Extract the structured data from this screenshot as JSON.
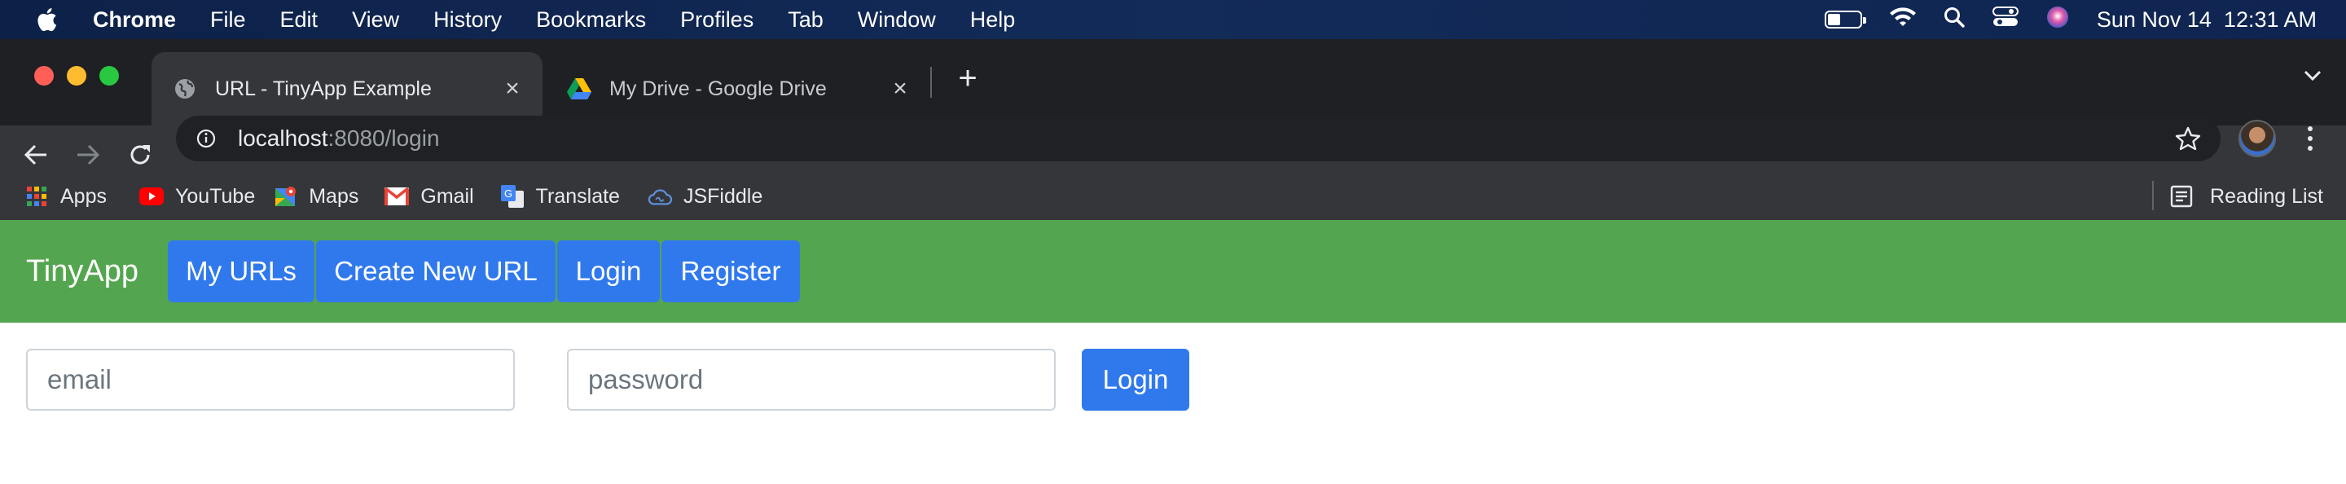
{
  "menubar": {
    "app_name": "Chrome",
    "items": [
      "File",
      "Edit",
      "View",
      "History",
      "Bookmarks",
      "Profiles",
      "Tab",
      "Window",
      "Help"
    ],
    "datetime": "Sun Nov 14  12:31 AM",
    "battery_level": 0.35
  },
  "browser": {
    "tabs": [
      {
        "title": "URL - TinyApp Example",
        "favicon": "globe-icon",
        "active": true
      },
      {
        "title": "My Drive - Google Drive",
        "favicon": "google-drive-icon",
        "active": false
      }
    ],
    "address": {
      "host": "localhost",
      "rest": ":8080/login"
    },
    "bookmarks": [
      {
        "label": "Apps",
        "icon": "apps-grid-icon"
      },
      {
        "label": "YouTube",
        "icon": "youtube-icon"
      },
      {
        "label": "Maps",
        "icon": "maps-icon"
      },
      {
        "label": "Gmail",
        "icon": "gmail-icon"
      },
      {
        "label": "Translate",
        "icon": "translate-icon"
      },
      {
        "label": "JSFiddle",
        "icon": "jsfiddle-icon"
      }
    ],
    "reading_list_label": "Reading List"
  },
  "page": {
    "brand": "TinyApp",
    "nav": [
      "My URLs",
      "Create New URL",
      "Login",
      "Register"
    ],
    "form": {
      "email_placeholder": "email",
      "email_value": "",
      "password_placeholder": "password",
      "password_value": "",
      "submit_label": "Login"
    }
  },
  "colors": {
    "navbar_green": "#54a54f",
    "button_blue": "#3079ed",
    "chrome_dark": "#35363a",
    "menubar_blue": "#132b59"
  }
}
